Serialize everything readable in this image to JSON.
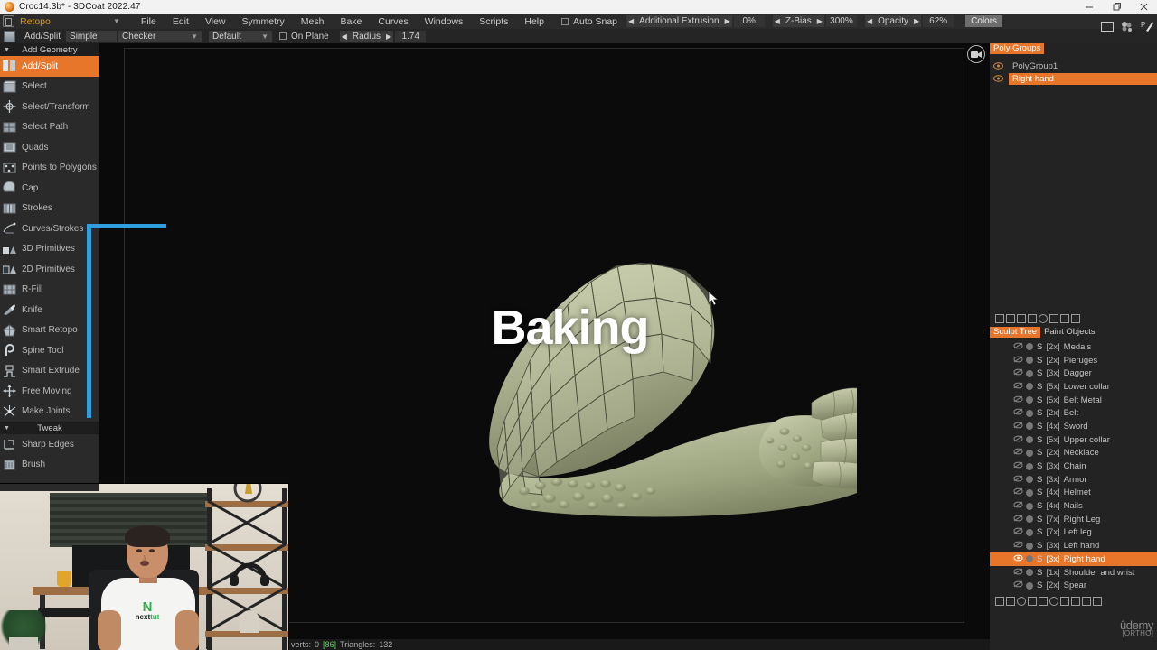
{
  "window": {
    "title": "Croc14.3b* - 3DCoat 2022.47",
    "icon": "app-icon",
    "controls": {
      "minimize": "minimize-icon",
      "maximize": "maximize-icon",
      "close": "close-icon"
    }
  },
  "menubar": {
    "workspace": "Retopo",
    "workspace_caret": "▼",
    "items": [
      "File",
      "Edit",
      "View",
      "Symmetry",
      "Mesh",
      "Bake",
      "Curves",
      "Windows",
      "Scripts",
      "Help"
    ],
    "auto_snap": {
      "label": "Auto Snap",
      "checked": false
    },
    "sliders": [
      {
        "label": "Additional Extrusion",
        "value": "0%"
      },
      {
        "label": "Z-Bias",
        "value": "300%"
      },
      {
        "label": "Opacity",
        "value": "62%"
      }
    ],
    "colors_button": "Colors"
  },
  "optionsbar": {
    "tool": "Add/Split",
    "mode": "Simple",
    "shader": "Checker",
    "preset": "Default",
    "on_plane": {
      "label": "On Plane",
      "checked": false
    },
    "radius": {
      "label": "Radius",
      "value": "1.74"
    }
  },
  "left_panel": {
    "header": "Add Geometry",
    "tweak_header": "Tweak",
    "tools": [
      {
        "label": "Add/Split",
        "icon": "add-split-icon",
        "active": true
      },
      {
        "label": "Select",
        "icon": "select-icon",
        "active": false
      },
      {
        "label": "Select/Transform",
        "icon": "select-transform-icon",
        "active": false
      },
      {
        "label": "Select Path",
        "icon": "select-path-icon",
        "active": false
      },
      {
        "label": "Quads",
        "icon": "quads-icon",
        "active": false
      },
      {
        "label": "Points to Polygons",
        "icon": "points-to-polygons-icon",
        "active": false
      },
      {
        "label": "Cap",
        "icon": "cap-icon",
        "active": false
      },
      {
        "label": "Strokes",
        "icon": "strokes-icon",
        "active": false
      },
      {
        "label": "Curves/Strokes",
        "icon": "curves-strokes-icon",
        "active": false
      },
      {
        "label": "3D Primitives",
        "icon": "3d-primitives-icon",
        "active": false
      },
      {
        "label": "2D Primitives",
        "icon": "2d-primitives-icon",
        "active": false
      },
      {
        "label": "R-Fill",
        "icon": "r-fill-icon",
        "active": false
      },
      {
        "label": "Knife",
        "icon": "knife-icon",
        "active": false
      },
      {
        "label": "Smart Retopo",
        "icon": "smart-retopo-icon",
        "active": false
      },
      {
        "label": "Spine Tool",
        "icon": "spine-tool-icon",
        "active": false
      },
      {
        "label": "Smart Extrude",
        "icon": "smart-extrude-icon",
        "active": false
      },
      {
        "label": "Free Moving",
        "icon": "free-moving-icon",
        "active": false
      },
      {
        "label": "Make Joints",
        "icon": "make-joints-icon",
        "active": false
      }
    ],
    "tweak_tools": [
      {
        "label": "Sharp Edges",
        "icon": "sharp-edges-icon",
        "active": false
      },
      {
        "label": "Brush",
        "icon": "brush-icon",
        "active": false
      }
    ]
  },
  "viewport": {
    "overlay_text": "Baking",
    "camera_badge": "camera-icon",
    "cursor": "mouse-cursor"
  },
  "right_panel": {
    "poly_groups": {
      "tab_label": "Poly Groups",
      "rows": [
        {
          "name": "PolyGroup1",
          "selected": false,
          "visible": true
        },
        {
          "name": "Right hand",
          "selected": true,
          "visible": true
        }
      ]
    },
    "sculpt_tree": {
      "tabs": [
        {
          "label": "Sculpt Tree",
          "active": true
        },
        {
          "label": "Paint Objects",
          "active": false
        }
      ],
      "rows": [
        {
          "count": "[2x]",
          "name": "Medals",
          "selected": false,
          "visible": false
        },
        {
          "count": "[2x]",
          "name": "Pieruges",
          "selected": false,
          "visible": false
        },
        {
          "count": "[3x]",
          "name": "Dagger",
          "selected": false,
          "visible": false
        },
        {
          "count": "[5x]",
          "name": "Lower collar",
          "selected": false,
          "visible": false
        },
        {
          "count": "[5x]",
          "name": "Belt Metal",
          "selected": false,
          "visible": false
        },
        {
          "count": "[2x]",
          "name": "Belt",
          "selected": false,
          "visible": false
        },
        {
          "count": "[4x]",
          "name": "Sword",
          "selected": false,
          "visible": false
        },
        {
          "count": "[5x]",
          "name": "Upper collar",
          "selected": false,
          "visible": false
        },
        {
          "count": "[2x]",
          "name": "Necklace",
          "selected": false,
          "visible": false
        },
        {
          "count": "[3x]",
          "name": "Chain",
          "selected": false,
          "visible": false
        },
        {
          "count": "[3x]",
          "name": "Armor",
          "selected": false,
          "visible": false
        },
        {
          "count": "[4x]",
          "name": "Helmet",
          "selected": false,
          "visible": false
        },
        {
          "count": "[4x]",
          "name": "Nails",
          "selected": false,
          "visible": false
        },
        {
          "count": "[7x]",
          "name": "Right Leg",
          "selected": false,
          "visible": false
        },
        {
          "count": "[7x]",
          "name": "Left leg",
          "selected": false,
          "visible": false
        },
        {
          "count": "[3x]",
          "name": "Left hand",
          "selected": false,
          "visible": false
        },
        {
          "count": "[3x]",
          "name": "Right hand",
          "selected": true,
          "visible": true
        },
        {
          "count": "[1x]",
          "name": "Shoulder and wrist",
          "selected": false,
          "visible": false
        },
        {
          "count": "[2x]",
          "name": "Spear",
          "selected": false,
          "visible": false
        }
      ]
    }
  },
  "statusbar": {
    "verts_label": "verts:",
    "verts_value": "0",
    "highlight": "[86]",
    "triangles_label": "Triangles:",
    "triangles_value": "132"
  },
  "watermark": {
    "brand": "ûdemy",
    "mode": "[ORTHO]"
  },
  "webcam": {
    "shirt_logo_n": "N",
    "shirt_logo_next": "next",
    "shirt_logo_tut": "tut"
  },
  "colors": {
    "accent_orange": "#e8762a",
    "annotation_blue": "#2f9fe0",
    "workspace_gold": "#d89a23",
    "status_green": "#5ad25a",
    "panel_bg": "#232323",
    "viewport_bg": "#0a0a0a"
  }
}
